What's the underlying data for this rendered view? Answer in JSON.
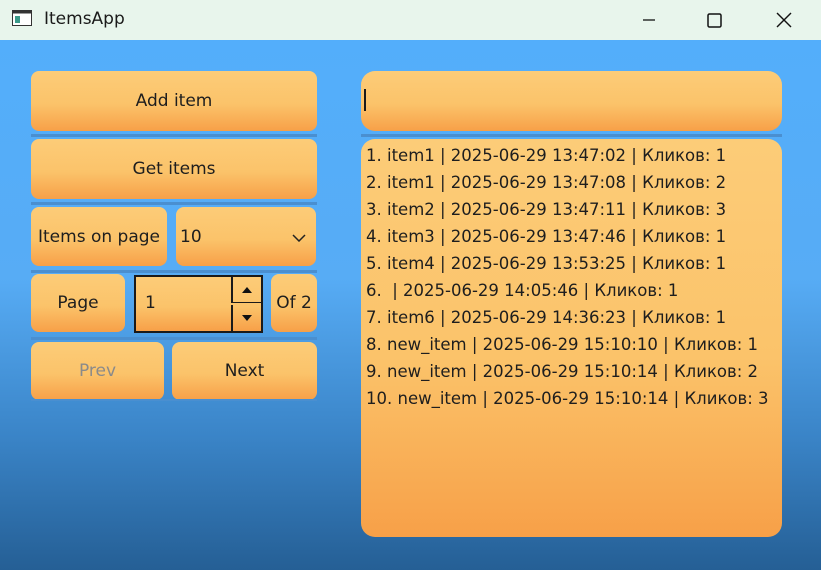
{
  "window": {
    "title": "ItemsApp"
  },
  "buttons": {
    "add_item": "Add item",
    "get_items": "Get items",
    "items_on_page": "Items on page",
    "page": "Page",
    "of_pages": "Of 2",
    "prev": "Prev",
    "next": "Next"
  },
  "items_per_page": {
    "selected": "10"
  },
  "page_spinner": {
    "value": "1"
  },
  "item_input": {
    "value": ""
  },
  "items_list": [
    "1. item1 | 2025-06-29 13:47:02 | Кликов: 1",
    "2. item1 | 2025-06-29 13:47:08 | Кликов: 2",
    "3. item2 | 2025-06-29 13:47:11 | Кликов: 3",
    "4. item3 | 2025-06-29 13:47:46 | Кликов: 1",
    "5. item4 | 2025-06-29 13:53:25 | Кликов: 1",
    "6.  | 2025-06-29 14:05:46 | Кликов: 1",
    "7. item6 | 2025-06-29 14:36:23 | Кликов: 1",
    "8. new_item | 2025-06-29 15:10:10 | Кликов: 1",
    "9. new_item | 2025-06-29 15:10:14 | Кликов: 2",
    "10. new_item | 2025-06-29 15:10:14 | Кликов: 3"
  ],
  "colors": {
    "titlebar": "#e8f5ec",
    "client_top": "#53aefb",
    "client_bottom": "#255f95",
    "button_top": "#fccc78",
    "button_bottom": "#f7a048"
  }
}
